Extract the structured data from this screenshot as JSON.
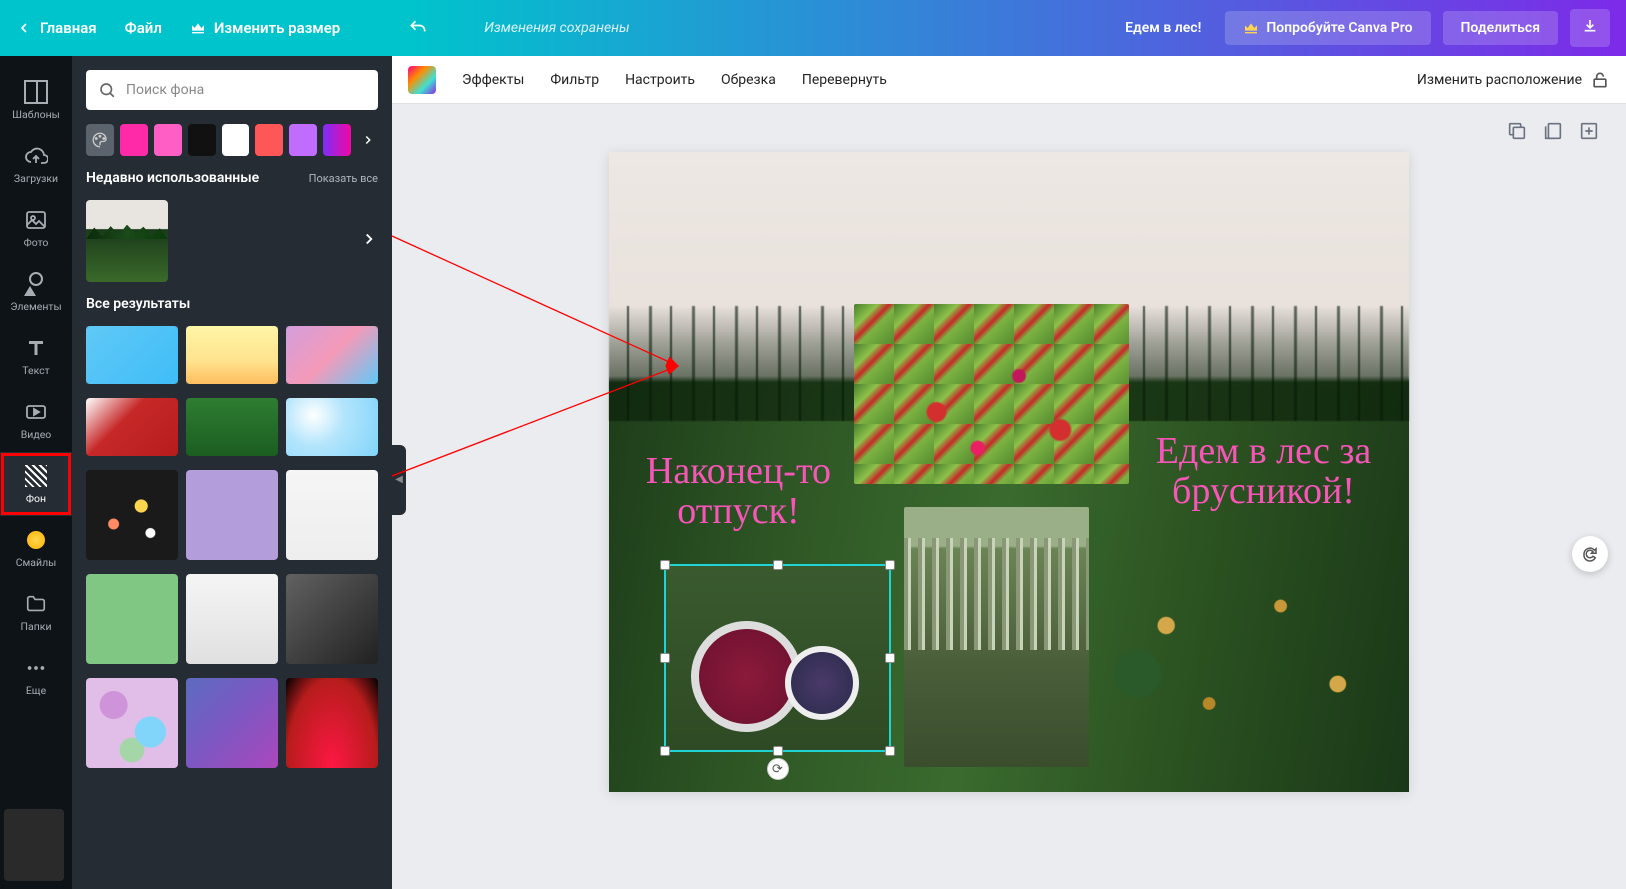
{
  "topbar": {
    "home": "Главная",
    "file": "Файл",
    "resize": "Изменить размер",
    "saved": "Изменения сохранены",
    "doc_title": "Едем в лес!",
    "try_pro": "Попробуйте Canva Pro",
    "share": "Поделиться"
  },
  "nav": {
    "templates": "Шаблоны",
    "uploads": "Загрузки",
    "photos": "Фото",
    "elements": "Элементы",
    "text": "Текст",
    "video": "Видео",
    "background": "Фон",
    "emoji": "Смайлы",
    "folders": "Папки",
    "more": "Еще"
  },
  "panel": {
    "search_placeholder": "Поиск фона",
    "recent": "Недавно использованные",
    "show_all": "Показать все",
    "all_results": "Все результаты"
  },
  "swatches": [
    "#ff2aa8",
    "#ff5ec4",
    "#111111",
    "#ffffff",
    "#ff5757",
    "#c06cff",
    "linear-gradient(90deg,#7b2ff7,#f107a3)"
  ],
  "ctx": {
    "effects": "Эффекты",
    "filter": "Фильтр",
    "adjust": "Настроить",
    "crop": "Обрезка",
    "flip": "Перевернуть",
    "position": "Изменить расположение"
  },
  "canvas": {
    "text1": "Наконец-то отпуск!",
    "text2": "Едем в лес за брусникой!"
  }
}
